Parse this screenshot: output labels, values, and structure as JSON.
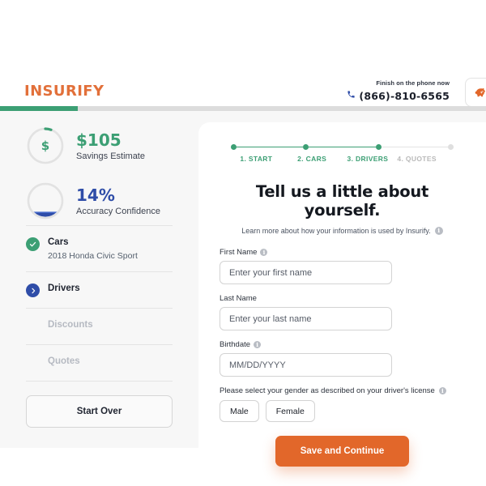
{
  "header": {
    "logo_text": "INSURIFY",
    "logo_color": "#E2703A",
    "phone_label": "Finish on the phone now",
    "phone_number": "(866)-810-6565",
    "phone_icon": "phone-icon",
    "piggy_icon": "piggy-bank-icon"
  },
  "top_progress": {
    "fill_percent": 16,
    "fill_color": "#3C9F74",
    "track_color": "#DCDCDC"
  },
  "sidebar": {
    "stats": [
      {
        "value": "$105",
        "label": "Savings Estimate",
        "icon": "dollar-icon",
        "color": "#3C9F74",
        "ring_percent": 8,
        "ring_type": "arc"
      },
      {
        "value": "14%",
        "label": "Accuracy Confidence",
        "icon": "",
        "color": "#2F4DA8",
        "ring_percent": 14,
        "ring_type": "fill"
      }
    ],
    "nav_items": [
      {
        "title": "Cars",
        "sub": "2018 Honda Civic Sport",
        "state": "done",
        "icon": "check-circle-icon"
      },
      {
        "title": "Drivers",
        "sub": "",
        "state": "active",
        "icon": "chevron-right-circle-icon"
      },
      {
        "title": "Discounts",
        "sub": "",
        "state": "disabled",
        "icon": ""
      },
      {
        "title": "Quotes",
        "sub": "",
        "state": "disabled",
        "icon": ""
      }
    ],
    "start_over_label": "Start Over"
  },
  "main": {
    "steps": [
      {
        "label": "1. START",
        "state": "on"
      },
      {
        "label": "2. CARS",
        "state": "on"
      },
      {
        "label": "3. DRIVERS",
        "state": "on"
      },
      {
        "label": "4. QUOTES",
        "state": "off"
      }
    ],
    "heading": "Tell us a little about yourself.",
    "subheading": "Learn more about how your information is used by Insurify.",
    "fields": {
      "first_name": {
        "label": "First Name",
        "placeholder": "Enter your first name",
        "value": "",
        "has_info": true
      },
      "last_name": {
        "label": "Last Name",
        "placeholder": "Enter your last name",
        "value": "",
        "has_info": false
      },
      "birthdate": {
        "label": "Birthdate",
        "placeholder": "MM/DD/YYYY",
        "value": "",
        "has_info": true
      }
    },
    "gender": {
      "label": "Please select your gender as described on your driver's license",
      "options": [
        "Male",
        "Female"
      ]
    },
    "cta_label": "Save and Continue",
    "cta_color": "#E2672A"
  }
}
